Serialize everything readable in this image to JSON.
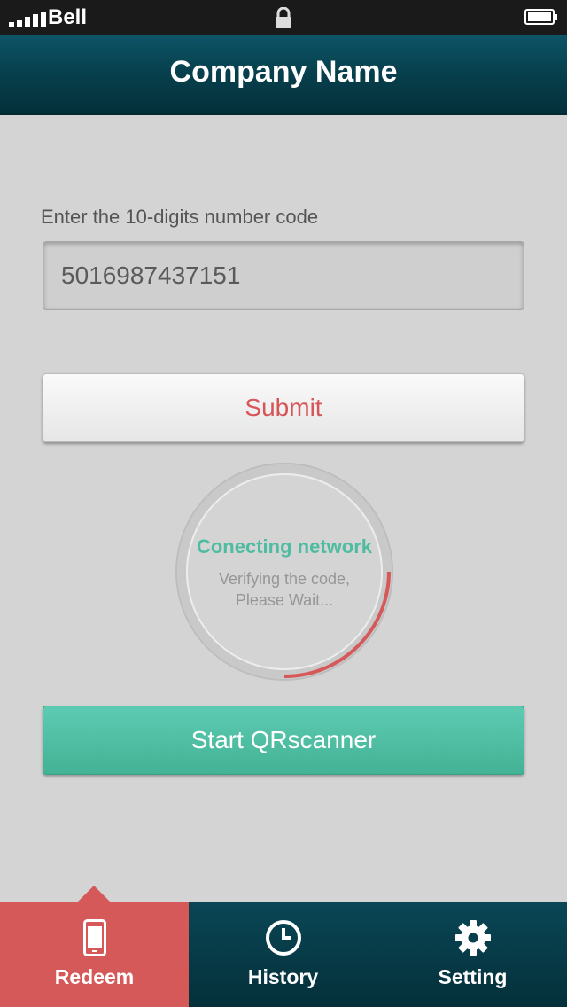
{
  "status_bar": {
    "carrier": "Bell"
  },
  "header": {
    "title": "Company Name"
  },
  "form": {
    "label": "Enter the 10-digits number code",
    "code_value": "5016987437151",
    "submit_label": "Submit"
  },
  "loader": {
    "title": "Conecting network",
    "line1": "Verifying the code,",
    "line2": "Please Wait...",
    "progress": 0.25
  },
  "qr_button": {
    "label": "Start QRscanner"
  },
  "tabs": [
    {
      "label": "Redeem",
      "icon": "phone-icon",
      "active": true
    },
    {
      "label": "History",
      "icon": "clock-icon",
      "active": false
    },
    {
      "label": "Setting",
      "icon": "gear-icon",
      "active": false
    }
  ],
  "colors": {
    "accent_red": "#d6595a",
    "accent_teal": "#4dbca1",
    "header_dark": "#073f4c"
  }
}
